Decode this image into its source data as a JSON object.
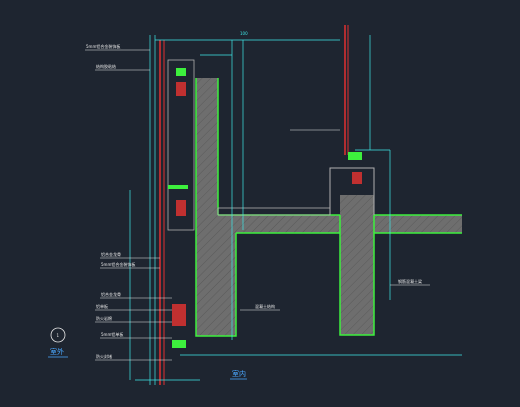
{
  "drawing": {
    "title": "室外",
    "room_label": "室内",
    "detail_number": "1",
    "top_dimension": "100",
    "callouts": [
      "5mm铝合金装饰板",
      "结构胶粘结",
      "铝合金龙骨",
      "5mm铝合金装饰板",
      "铝合金龙骨",
      "铝单板",
      "防火岩棉",
      "5mm铝单板",
      "防火封堵"
    ],
    "right_callouts": [
      "混凝土结构",
      "钢筋混凝土梁"
    ],
    "colors": {
      "background": "#1e2530",
      "concrete": "#7a7a7a",
      "edge": "#3df03d",
      "dimension": "#3ee8e8",
      "glass": "#e03030",
      "text": "#e8e8e8"
    }
  }
}
